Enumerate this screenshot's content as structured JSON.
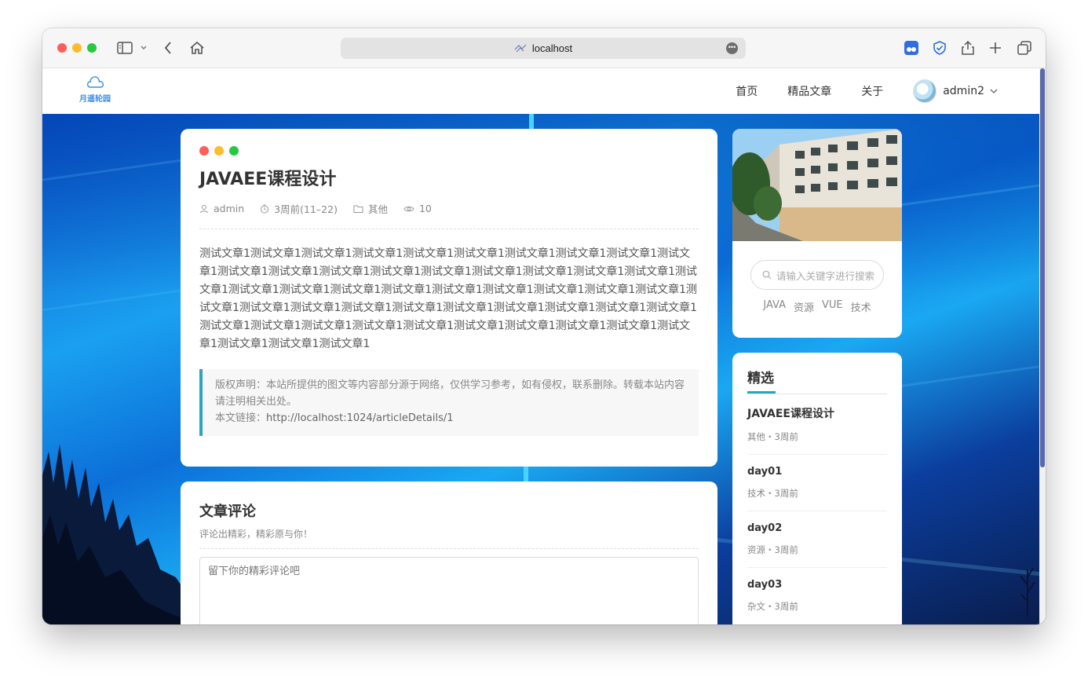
{
  "browser": {
    "url": "localhost",
    "traffic_lights": [
      "#fe5f57",
      "#febc2e",
      "#28c840"
    ]
  },
  "site": {
    "logo_text": "月遥轮园",
    "nav": [
      "首页",
      "精品文章",
      "关于"
    ],
    "user": "admin2"
  },
  "article": {
    "title": "JAVAEE课程设计",
    "meta": {
      "author": "admin",
      "time": "3周前(11–22)",
      "category": "其他",
      "views": "10"
    },
    "body": "测试文章1测试文章1测试文章1测试文章1测试文章1测试文章1测试文章1测试文章1测试文章1测试文章1测试文章1测试文章1测试文章1测试文章1测试文章1测试文章1测试文章1测试文章1测试文章1测试文章1测试文章1测试文章1测试文章1测试文章1测试文章1测试文章1测试文章1测试文章1测试文章1测试文章1测试文章1测试文章1测试文章1测试文章1测试文章1测试文章1测试文章1测试文章1测试文章1测试文章1测试文章1测试文章1测试文章1测试文章1测试文章1测试文章1测试文章1测试文章1测试文章1测试文章1测试文章1测试文章1",
    "copyright": "版权声明：本站所提供的图文等内容部分源于网络，仅供学习参考，如有侵权，联系删除。转载本站内容请注明相关出处。",
    "link_label": "本文链接：",
    "link": "http://localhost:1024/articleDetails/1"
  },
  "comments": {
    "title": "文章评论",
    "subtitle": "评论出精彩，精彩原与你！",
    "placeholder": "留下你的精彩评论吧"
  },
  "sidebar": {
    "search_placeholder": "请输入关键字进行搜索",
    "tags": [
      "JAVA",
      "资源",
      "VUE",
      "技术"
    ],
    "featured_title": "精选",
    "featured": [
      {
        "title": "JAVAEE课程设计",
        "meta": "其他・3周前"
      },
      {
        "title": "day01",
        "meta": "技术・3周前"
      },
      {
        "title": "day02",
        "meta": "资源・3周前"
      },
      {
        "title": "day03",
        "meta": "杂文・3周前"
      }
    ]
  },
  "colors": {
    "accent": "#2aa5c0",
    "brand": "#3a8ee6"
  }
}
